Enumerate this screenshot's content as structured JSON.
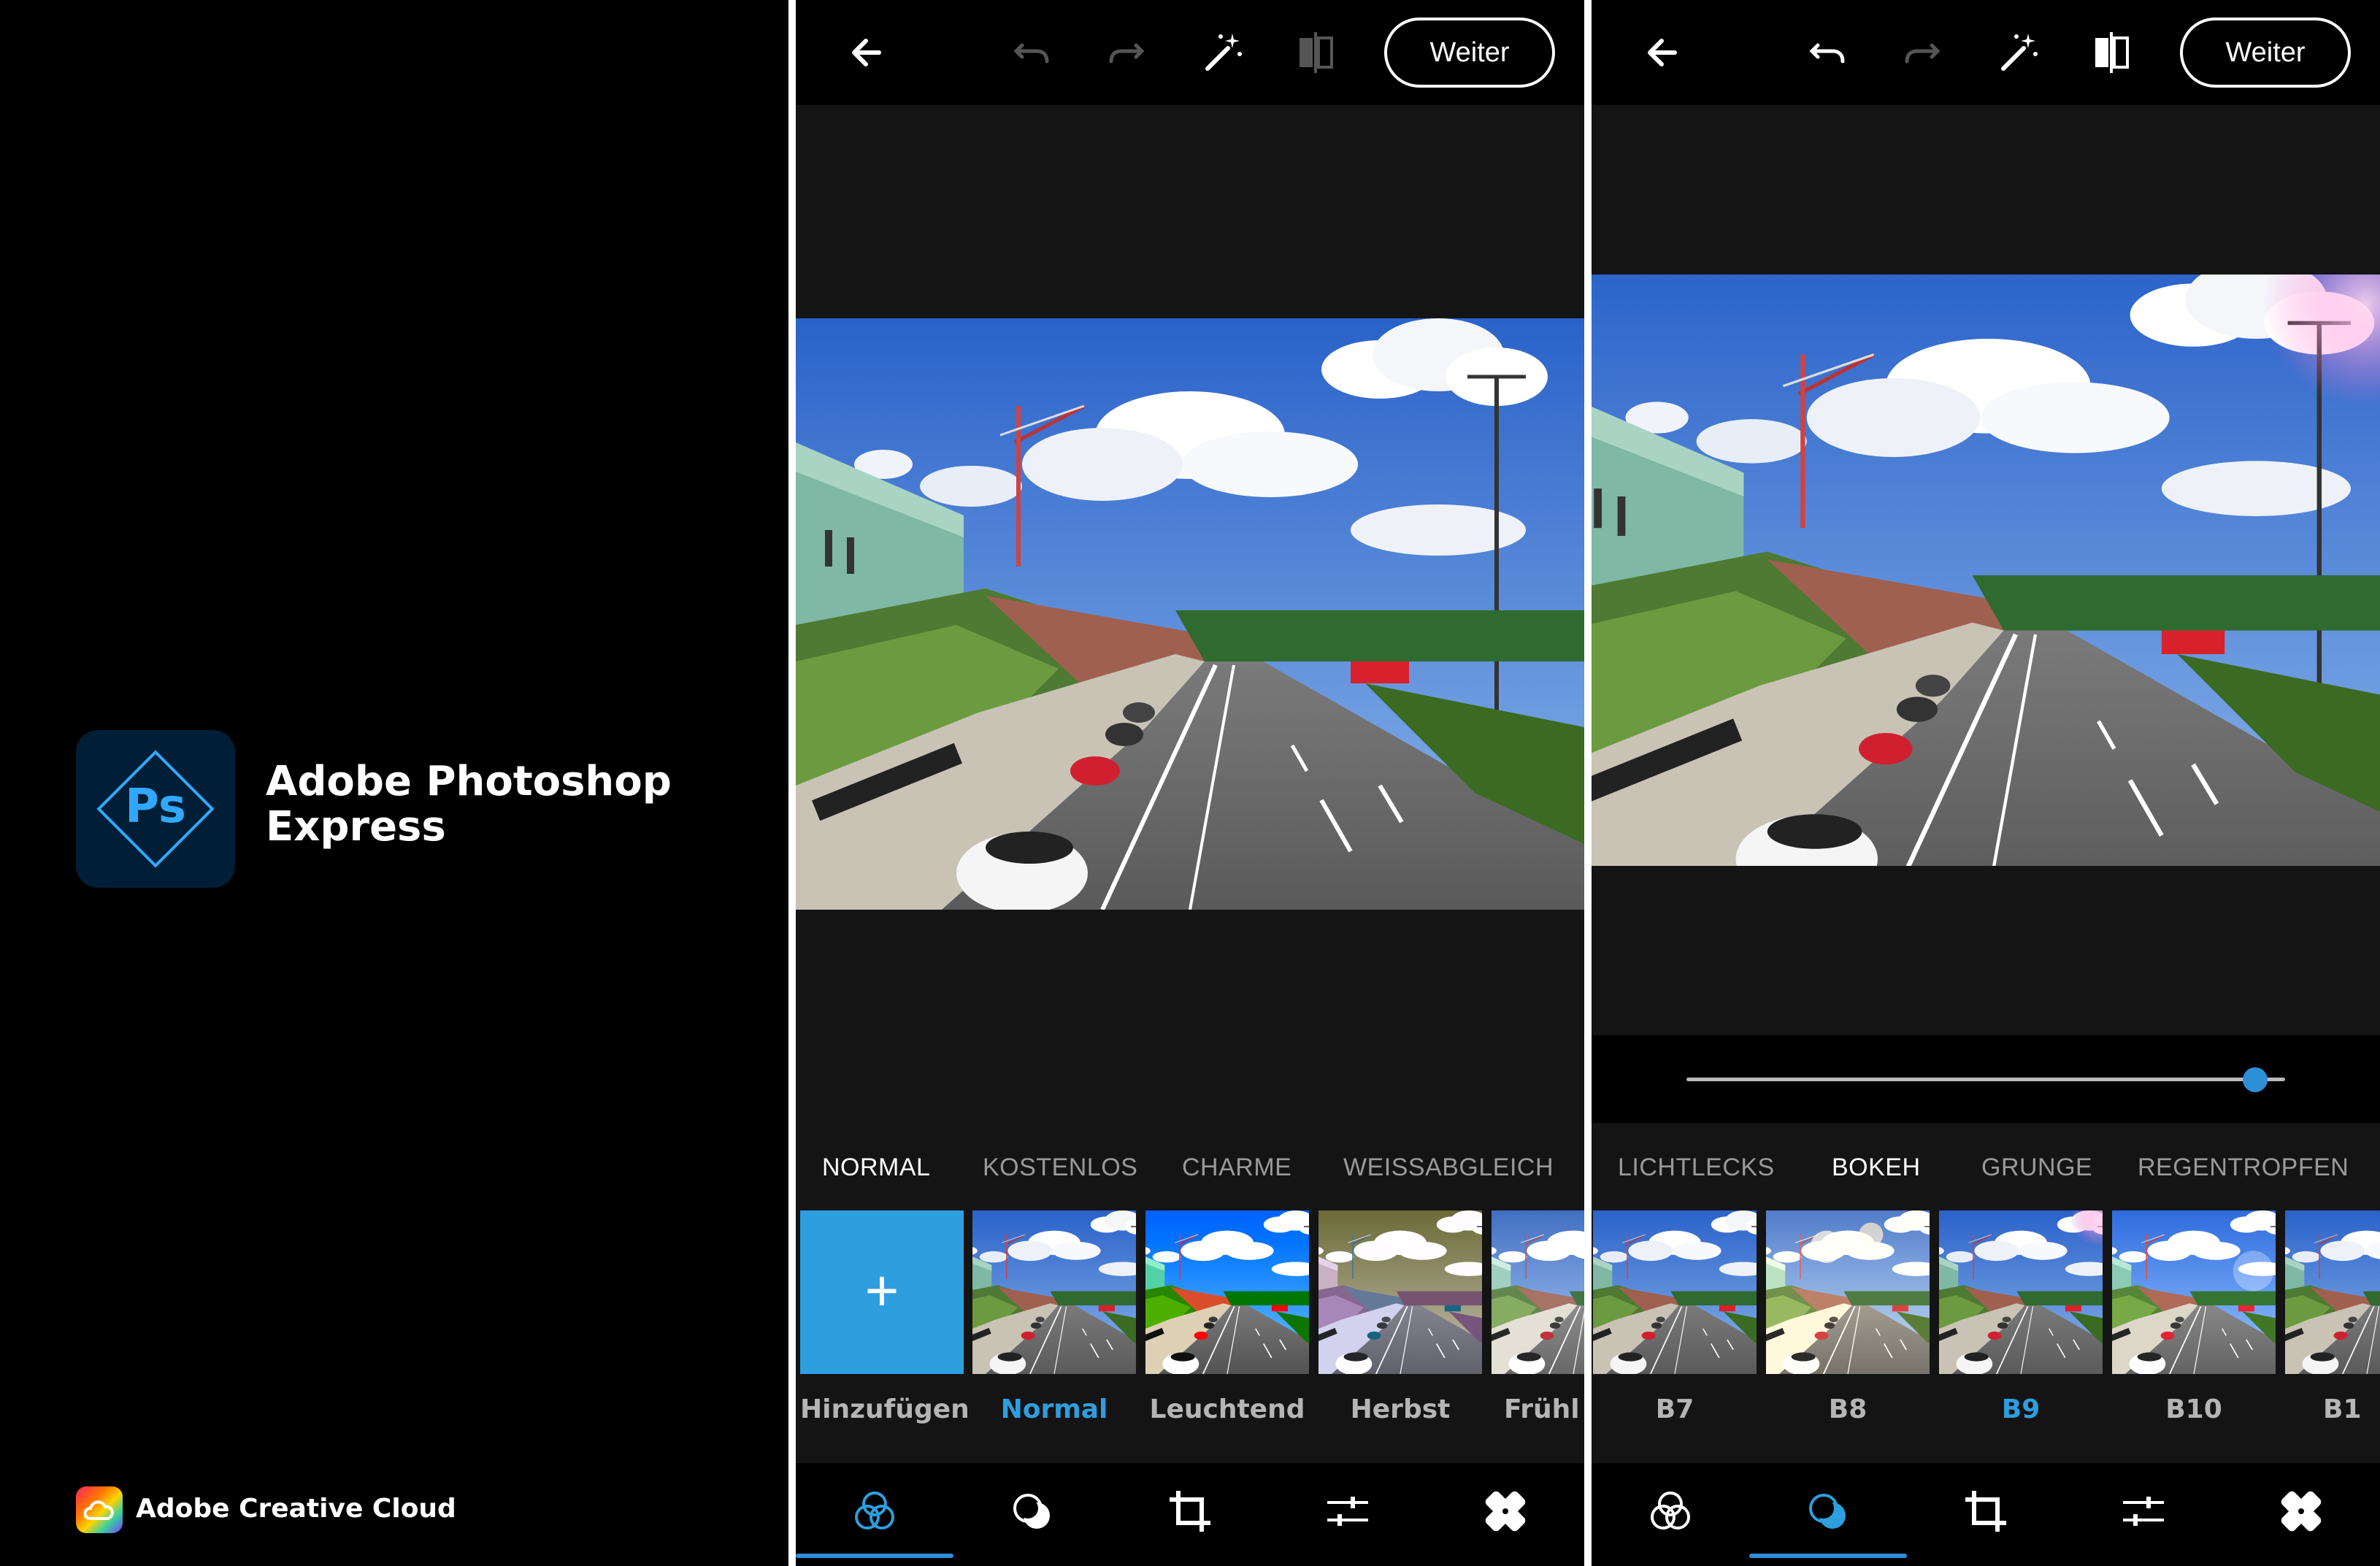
{
  "brand": {
    "app_name_line1": "Adobe Photoshop",
    "app_name_line2": "Express",
    "logo_text": "Ps",
    "cc_label": "Adobe Creative Cloud"
  },
  "colors": {
    "accent": "#2d9fdf",
    "background": "#000000",
    "panel": "#141414",
    "ps_logo_bg": "#001e36",
    "ps_logo_fg": "#31a8ff"
  },
  "screen_a": {
    "toolbar": {
      "back_icon": "arrow-left-icon",
      "undo_icon": "undo-icon",
      "redo_icon": "redo-icon",
      "auto_fix_icon": "magic-wand-icon",
      "compare_icon": "compare-icon",
      "next_label": "Weiter"
    },
    "categories": [
      "NORMAL",
      "KOSTENLOS",
      "CHARME",
      "WEISSABGLEICH"
    ],
    "active_category": "NORMAL",
    "filters": [
      {
        "label": "Hinzufügen",
        "type": "add"
      },
      {
        "label": "Normal",
        "type": "photo",
        "active": true
      },
      {
        "label": "Leuchtend",
        "type": "photo"
      },
      {
        "label": "Herbst",
        "type": "photo"
      },
      {
        "label": "Frühl",
        "type": "photo"
      }
    ],
    "bottom_tabs": [
      "looks-icon",
      "overlays-icon",
      "crop-icon",
      "adjust-icon",
      "heal-icon"
    ],
    "active_tab": "looks-icon"
  },
  "screen_b": {
    "toolbar": {
      "back_icon": "arrow-left-icon",
      "undo_icon": "undo-icon",
      "redo_icon": "redo-icon",
      "auto_fix_icon": "magic-wand-icon",
      "compare_icon": "compare-icon",
      "next_label": "Weiter"
    },
    "slider_value_fraction": 0.95,
    "categories": [
      "LICHTLECKS",
      "BOKEH",
      "GRUNGE",
      "REGENTROPFEN"
    ],
    "active_category": "BOKEH",
    "filters": [
      {
        "label": "B7",
        "type": "photo"
      },
      {
        "label": "B8",
        "type": "photo"
      },
      {
        "label": "B9",
        "type": "photo",
        "active": true
      },
      {
        "label": "B10",
        "type": "photo"
      },
      {
        "label": "B1",
        "type": "photo"
      }
    ],
    "bottom_tabs": [
      "looks-icon",
      "overlays-icon",
      "crop-icon",
      "adjust-icon",
      "heal-icon"
    ],
    "active_tab": "overlays-icon"
  }
}
